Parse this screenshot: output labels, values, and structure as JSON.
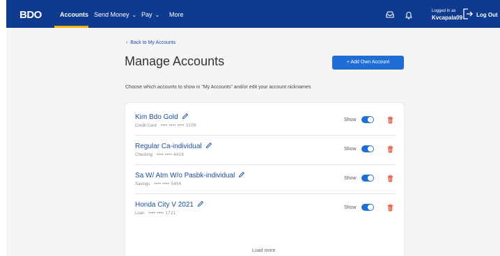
{
  "header": {
    "logo_text": "BDO",
    "nav": [
      {
        "label": "Accounts"
      },
      {
        "label": "Send Money"
      },
      {
        "label": "Pay"
      },
      {
        "label": "More"
      }
    ],
    "logged_in_label": "Logged in as",
    "username": "Kvcapala09",
    "logout_label": "Log Out",
    "icons": [
      "inbox-icon",
      "bell-icon",
      "logout-icon"
    ]
  },
  "page": {
    "back_link": "Back to My Accounts",
    "title": "Manage Accounts",
    "add_button": "+ Add Own Account",
    "subtitle": "Choose which accounts to show in \"My Accounts\" and/or edit your account nicknames"
  },
  "accounts": [
    {
      "name": "Kim Bdo Gold",
      "type": "Credit Card",
      "masked": "•••• •••• •••• 3109",
      "show_label": "Show",
      "shown": true
    },
    {
      "name": "Regular Ca-individual",
      "type": "Checking",
      "masked": "•••• •••• 4419",
      "show_label": "Show",
      "shown": true
    },
    {
      "name": "Sa W/ Atm W/o Pasbk-individual",
      "type": "Savings",
      "masked": "•••• •••• 5456",
      "show_label": "Show",
      "shown": true
    },
    {
      "name": "Honda City V 2021",
      "type": "Loan",
      "masked": "•••• •••• 1721",
      "show_label": "Show",
      "shown": true
    }
  ],
  "load_more": "Load more",
  "colors": {
    "header_bg": "#0e3a8f",
    "accent_yellow": "#f4b400",
    "primary_blue": "#1f6ed6",
    "account_name": "#1c4c9c",
    "trash_red": "#e8614a"
  }
}
